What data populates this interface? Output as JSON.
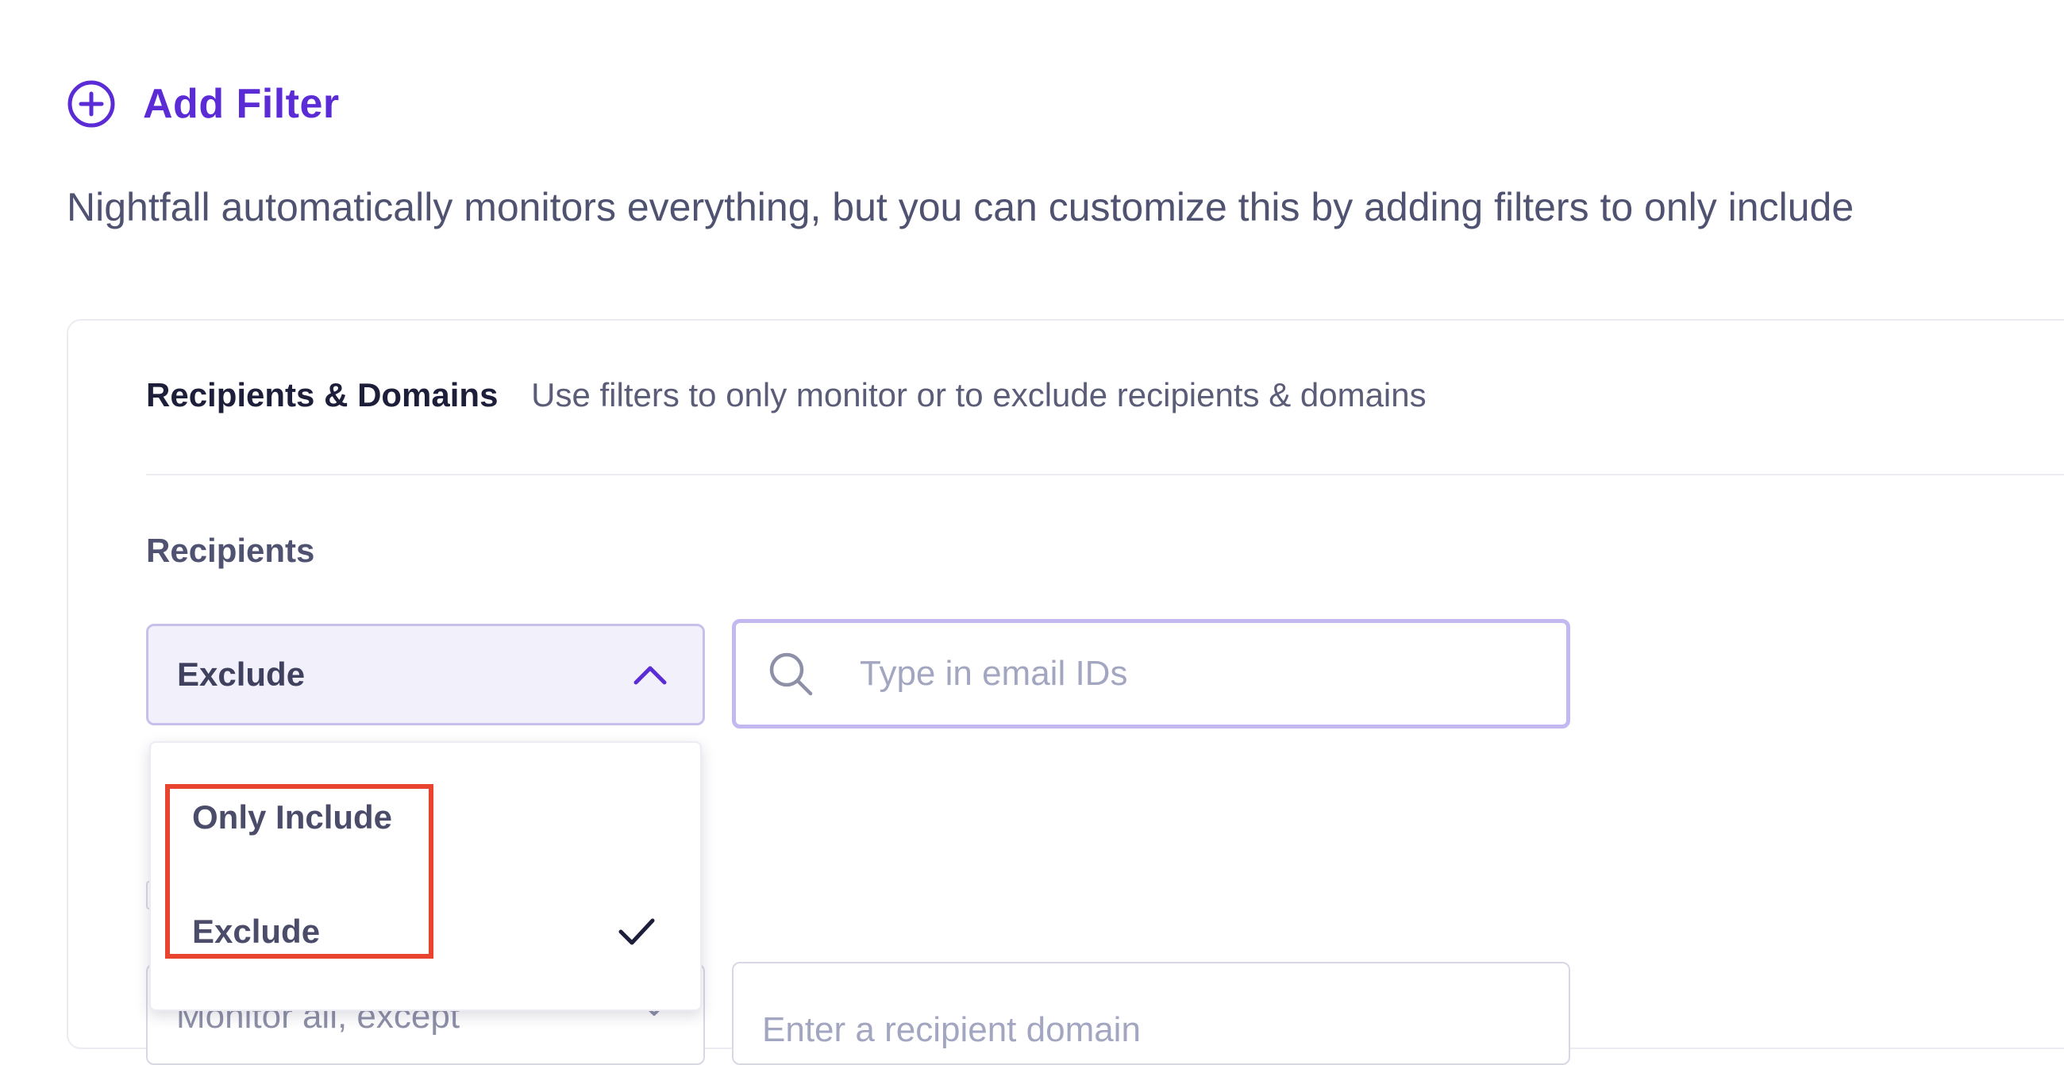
{
  "add_filter": {
    "label": "Add Filter",
    "icon": "plus-circle-icon"
  },
  "intro_text": "Nightfall automatically monitors everything, but you can customize this by adding filters to only include",
  "section": {
    "title": "Recipients & Domains",
    "description": "Use filters to only monitor or to exclude recipients & domains"
  },
  "recipients": {
    "label": "Recipients",
    "mode_select": {
      "selected": "Exclude",
      "options": [
        {
          "label": "Only Include",
          "checked": false
        },
        {
          "label": "Exclude",
          "checked": true
        }
      ]
    },
    "email_search": {
      "placeholder": "Type in email IDs",
      "value": ""
    }
  },
  "domains": {
    "mode_select": {
      "selected": "Monitor all, except"
    },
    "domain_input": {
      "placeholder": "Enter a recipient domain",
      "value": ""
    }
  },
  "colors": {
    "accent": "#5b2bd6",
    "highlight": "#e8442f",
    "select_bg": "#f2f0fb"
  }
}
